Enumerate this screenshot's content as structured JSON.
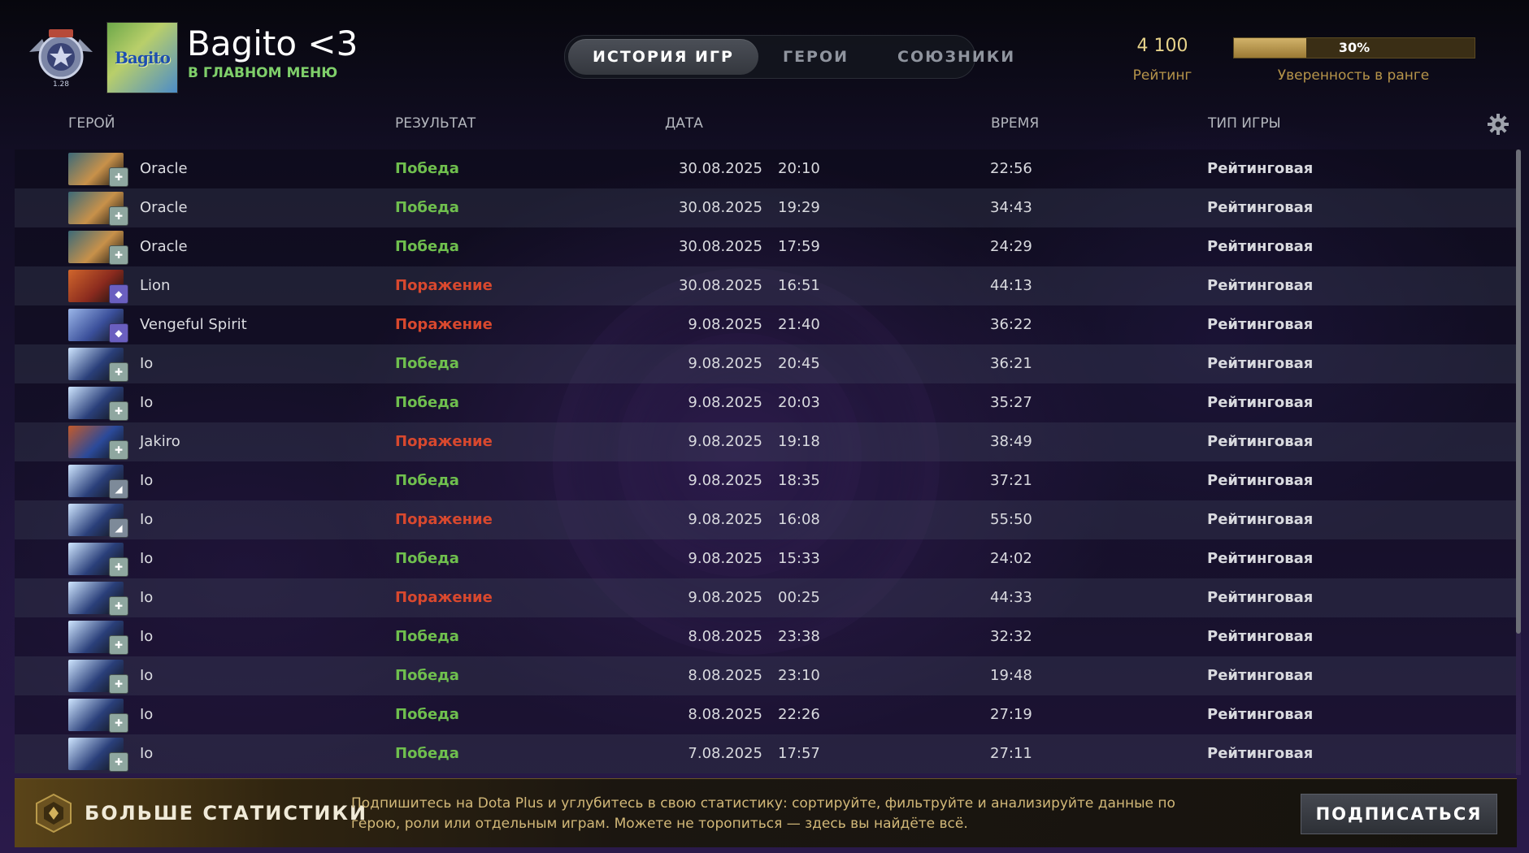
{
  "player": {
    "name": "Bagito <3",
    "status": "В ГЛАВНОМ МЕНЮ",
    "avatar_text": "Bagito",
    "rank_badge_text": "1.28"
  },
  "tabs": [
    {
      "label": "ИСТОРИЯ ИГР",
      "active": true
    },
    {
      "label": "ГЕРОИ",
      "active": false
    },
    {
      "label": "СОЮЗНИКИ",
      "active": false
    }
  ],
  "rating": {
    "value": "4 100",
    "label": "Рейтинг",
    "confidence_percent": 30,
    "confidence_text": "30%",
    "confidence_label": "Уверенность в ранге"
  },
  "columns": {
    "hero": "ГЕРОЙ",
    "result": "РЕЗУЛЬТАТ",
    "date": "ДАТА",
    "duration": "ВРЕМЯ",
    "mode": "ТИП ИГРЫ"
  },
  "settings_icon": "gear-icon",
  "matches": [
    {
      "hero": "Oracle",
      "result": "Победа",
      "win": true,
      "date": "30.08.2025",
      "time": "20:10",
      "duration": "22:56",
      "mode": "Рейтинговая",
      "role": "support"
    },
    {
      "hero": "Oracle",
      "result": "Победа",
      "win": true,
      "date": "30.08.2025",
      "time": "19:29",
      "duration": "34:43",
      "mode": "Рейтинговая",
      "role": "support"
    },
    {
      "hero": "Oracle",
      "result": "Победа",
      "win": true,
      "date": "30.08.2025",
      "time": "17:59",
      "duration": "24:29",
      "mode": "Рейтинговая",
      "role": "support"
    },
    {
      "hero": "Lion",
      "result": "Поражение",
      "win": false,
      "date": "30.08.2025",
      "time": "16:51",
      "duration": "44:13",
      "mode": "Рейтинговая",
      "role": "hard-support"
    },
    {
      "hero": "Vengeful Spirit",
      "result": "Поражение",
      "win": false,
      "date": "9.08.2025",
      "time": "21:40",
      "duration": "36:22",
      "mode": "Рейтинговая",
      "role": "hard-support"
    },
    {
      "hero": "Io",
      "result": "Победа",
      "win": true,
      "date": "9.08.2025",
      "time": "20:45",
      "duration": "36:21",
      "mode": "Рейтинговая",
      "role": "support"
    },
    {
      "hero": "Io",
      "result": "Победа",
      "win": true,
      "date": "9.08.2025",
      "time": "20:03",
      "duration": "35:27",
      "mode": "Рейтинговая",
      "role": "support"
    },
    {
      "hero": "Jakiro",
      "result": "Поражение",
      "win": false,
      "date": "9.08.2025",
      "time": "19:18",
      "duration": "38:49",
      "mode": "Рейтинговая",
      "role": "support"
    },
    {
      "hero": "Io",
      "result": "Победа",
      "win": true,
      "date": "9.08.2025",
      "time": "18:35",
      "duration": "37:21",
      "mode": "Рейтинговая",
      "role": "offlane"
    },
    {
      "hero": "Io",
      "result": "Поражение",
      "win": false,
      "date": "9.08.2025",
      "time": "16:08",
      "duration": "55:50",
      "mode": "Рейтинговая",
      "role": "offlane"
    },
    {
      "hero": "Io",
      "result": "Победа",
      "win": true,
      "date": "9.08.2025",
      "time": "15:33",
      "duration": "24:02",
      "mode": "Рейтинговая",
      "role": "support"
    },
    {
      "hero": "Io",
      "result": "Поражение",
      "win": false,
      "date": "9.08.2025",
      "time": "00:25",
      "duration": "44:33",
      "mode": "Рейтинговая",
      "role": "support"
    },
    {
      "hero": "Io",
      "result": "Победа",
      "win": true,
      "date": "8.08.2025",
      "time": "23:38",
      "duration": "32:32",
      "mode": "Рейтинговая",
      "role": "support"
    },
    {
      "hero": "Io",
      "result": "Победа",
      "win": true,
      "date": "8.08.2025",
      "time": "23:10",
      "duration": "19:48",
      "mode": "Рейтинговая",
      "role": "support"
    },
    {
      "hero": "Io",
      "result": "Победа",
      "win": true,
      "date": "8.08.2025",
      "time": "22:26",
      "duration": "27:19",
      "mode": "Рейтинговая",
      "role": "support"
    },
    {
      "hero": "Io",
      "result": "Победа",
      "win": true,
      "date": "7.08.2025",
      "time": "17:57",
      "duration": "27:11",
      "mode": "Рейтинговая",
      "role": "support"
    }
  ],
  "hero_colors": {
    "Oracle": [
      "#c8914a",
      "#3c6a78"
    ],
    "Lion": [
      "#8a2a1e",
      "#d0662c"
    ],
    "Vengeful Spirit": [
      "#3a4f9a",
      "#9bb6e8"
    ],
    "Io": [
      "#2a3f7a",
      "#cfe6ff"
    ],
    "Jakiro": [
      "#2b4a9a",
      "#c45a2a"
    ]
  },
  "colors": {
    "win": "#6fbf4e",
    "loss": "#d8482e",
    "accent_gold": "#b6944a"
  },
  "promo": {
    "title": "БОЛЬШЕ СТАТИСТИКИ",
    "text": "Подпишитесь на Dota Plus и углубитесь в свою статистику: сортируйте, фильтруйте и анализируйте данные по герою, роли или отдельным играм. Можете не торопиться — здесь вы найдёте всё.",
    "button": "ПОДПИСАТЬСЯ",
    "icon": "dota-plus-icon"
  }
}
